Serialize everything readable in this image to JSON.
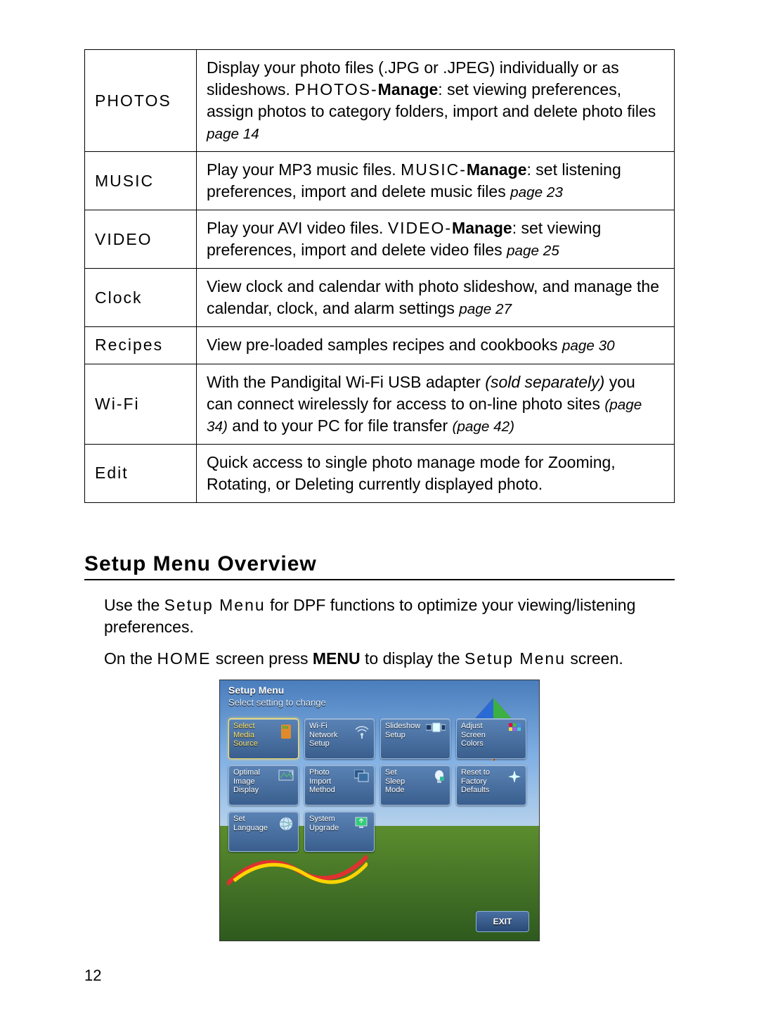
{
  "table": {
    "rows": [
      {
        "label": "PHOTOS",
        "desc_pre": "Display your photo files (.JPG or .JPEG) individually or as slideshows. ",
        "manage_label": "PHOTOS-",
        "manage_bold": "Manage",
        "desc_post": ": set viewing preferences, assign photos to category folders, import and delete photo files ",
        "pageref": "page 14"
      },
      {
        "label": "MUSIC",
        "desc_pre": "Play your MP3 music files. ",
        "manage_label": "MUSIC-",
        "manage_bold": "Manage",
        "desc_post": ": set listening preferences, import and delete music files ",
        "pageref": "page 23"
      },
      {
        "label": "VIDEO",
        "desc_pre": "Play your AVI video files. ",
        "manage_label": "VIDEO-",
        "manage_bold": "Manage",
        "desc_post": ": set viewing preferences, import and delete video files ",
        "pageref": "page 25"
      },
      {
        "label": "Clock",
        "desc_pre": "View clock and calendar with photo slideshow, and manage the calendar, clock, and alarm settings ",
        "manage_label": "",
        "manage_bold": "",
        "desc_post": "",
        "pageref": "page 27"
      },
      {
        "label": "Recipes",
        "desc_pre": "View pre-loaded samples recipes and cookbooks ",
        "manage_label": "",
        "manage_bold": "",
        "desc_post": "",
        "pageref": "page 30"
      }
    ],
    "wifi": {
      "label": "Wi-Fi",
      "part1": "With the Pandigital Wi-Fi USB adapter ",
      "italic1": "(sold separately)",
      "part2": " you can connect wirelessly for access to on-line photo sites ",
      "pageref1": "(page 34)",
      "part3": " and to your PC for file transfer ",
      "pageref2": "(page 42)"
    },
    "edit": {
      "label": "Edit",
      "desc": "Quick access to single photo manage mode for Zooming, Rotating, or Deleting currently displayed photo."
    }
  },
  "section_heading": "Setup Menu Overview",
  "para1": {
    "a": "Use the ",
    "menu": "Setup Menu",
    "b": " for DPF functions to optimize your viewing/listening preferences."
  },
  "para2": {
    "a": "On the ",
    "home": "HOME",
    "b": " screen press ",
    "menu_bold": "MENU",
    "c": " to display the ",
    "setup": "Setup Menu",
    "d": " screen."
  },
  "screen": {
    "title": "Setup Menu",
    "subtitle": "Select setting to change",
    "tiles": [
      [
        "Select",
        "Media",
        "Source"
      ],
      [
        "Wi-Fi",
        "Network",
        "Setup"
      ],
      [
        "",
        "Slideshow",
        "Setup"
      ],
      [
        "Adjust",
        "Screen",
        "Colors"
      ],
      [
        "Optimal",
        "Image",
        "Display"
      ],
      [
        "Photo",
        "Import",
        "Method"
      ],
      [
        "Set",
        "Sleep",
        "Mode"
      ],
      [
        "Reset to",
        "Factory",
        "Defaults"
      ],
      [
        "Set",
        "Language",
        ""
      ],
      [
        "System",
        "Upgrade",
        ""
      ]
    ],
    "exit": "EXIT"
  },
  "page_number": "12"
}
